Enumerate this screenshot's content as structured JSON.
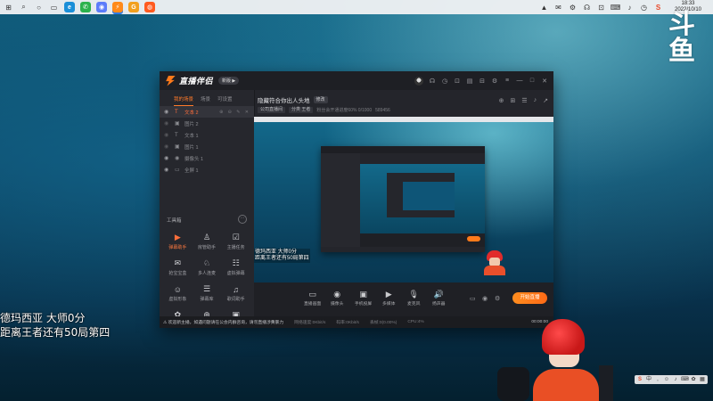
{
  "taskbar": {
    "left_icons": [
      {
        "name": "windows-icon",
        "glyph": "⊞"
      },
      {
        "name": "search-icon",
        "glyph": "⌕"
      },
      {
        "name": "circle-icon",
        "glyph": "○"
      },
      {
        "name": "task-view-icon",
        "glyph": "▭"
      }
    ],
    "apps": [
      {
        "name": "edge-app",
        "glyph": "e",
        "color": "#1b8fd8"
      },
      {
        "name": "wechat-app",
        "glyph": "✆",
        "color": "#2bb24c"
      },
      {
        "name": "browser-app",
        "glyph": "◉",
        "color": "#5c7cfa"
      },
      {
        "name": "live-companion-app",
        "glyph": "⚡",
        "color": "#ff8a1a",
        "active": true
      },
      {
        "name": "g-app",
        "glyph": "G",
        "color": "#f2a01e"
      },
      {
        "name": "firefox-app",
        "glyph": "◍",
        "color": "#ff5a1f"
      }
    ],
    "tray_icons": [
      "▲",
      "✉",
      "⚙",
      "☊",
      "⊡",
      "⌨",
      "♪",
      "◷",
      "S"
    ],
    "time": "18:33",
    "date": "2022/10/10"
  },
  "watermark": {
    "glyph": "斗鱼"
  },
  "app": {
    "name": "直播伴侣",
    "version_badge": "新版 ▶",
    "title_icons": [
      "☊",
      "◷",
      "⊡",
      "▤",
      "⊟",
      "⚙",
      "≡",
      "—",
      "□",
      "✕"
    ],
    "left_tabs": [
      {
        "label": "我的场景",
        "active": true
      },
      {
        "label": "场景",
        "active": false
      },
      {
        "label": "可设置",
        "active": false
      }
    ],
    "sources": [
      {
        "label": "文本 2",
        "icon": "T",
        "visible": true,
        "selected": true,
        "tools": "⊕ ⊖ ✎ ✕"
      },
      {
        "label": "图片 2",
        "icon": "▣",
        "visible": false,
        "selected": false
      },
      {
        "label": "文本 1",
        "icon": "T",
        "visible": false,
        "selected": false
      },
      {
        "label": "图片 1",
        "icon": "▣",
        "visible": false,
        "selected": false
      },
      {
        "label": "摄像头 1",
        "icon": "◉",
        "visible": true,
        "selected": false
      },
      {
        "label": "全屏 1",
        "icon": "▭",
        "visible": true,
        "selected": false
      }
    ],
    "tools_title": "工具箱",
    "tools_more": "···",
    "tools": [
      {
        "label": "弹幕助手",
        "icon": "▶",
        "hot": true
      },
      {
        "label": "房管助手",
        "icon": "♙",
        "hot": false
      },
      {
        "label": "主播任务",
        "icon": "☑",
        "hot": false
      },
      {
        "label": "抢宝宝盒",
        "icon": "✉",
        "hot": false
      },
      {
        "label": "多人连麦",
        "icon": "♘",
        "hot": false
      },
      {
        "label": "虚拟弹幕",
        "icon": "☷",
        "hot": false
      },
      {
        "label": "虚拟形象",
        "icon": "☺",
        "hot": false
      },
      {
        "label": "弹幕库",
        "icon": "☰",
        "hot": false
      },
      {
        "label": "歌词助手",
        "icon": "♫",
        "hot": false
      },
      {
        "label": "礼物",
        "icon": "✿",
        "hot": false
      },
      {
        "label": "更多",
        "icon": "⊕",
        "hot": false
      },
      {
        "label": "设置",
        "icon": "▣",
        "hot": false
      }
    ],
    "stream_title": "隐藏符合你出人头地",
    "mod_button": "修改",
    "stream_tags": [
      "公司直播间",
      "分类 王者"
    ],
    "stream_sub_text": "粉丝会开通进度60%  0/1000",
    "room_id": "589456",
    "right_icons": [
      "⊕",
      "⊞",
      "☰",
      "♪",
      "↗"
    ],
    "preview_overlay": [
      "德玛西亚  大师0分",
      "距离王者还有50局第四"
    ],
    "actions": [
      {
        "label": "直播画面",
        "icon": "▭"
      },
      {
        "label": "摄像头",
        "icon": "◉"
      },
      {
        "label": "手机投屏",
        "icon": "▣"
      },
      {
        "label": "多媒体",
        "icon": "▶"
      },
      {
        "label": "麦克风",
        "icon": "🎙"
      },
      {
        "label": "扬声器",
        "icon": "🔊"
      }
    ],
    "action_side_icons": [
      "▭",
      "◉",
      "⚙"
    ],
    "live_button": "开始直播",
    "status_notice": "⚠ 欢迎新主播，如遇问题请在公会内群咨询，请勿直播涉黄暴力",
    "stats": [
      "网络速度:0Kbit/s",
      "码率:0Kbit/s",
      "丢帧:0(0.00%)",
      "CPU:4%"
    ],
    "status_time": "00:00:00"
  },
  "overlay_text": [
    "德玛西亚  大师0分",
    "距离王者还有50局第四"
  ],
  "colors": {
    "accent": "#ff7a1a",
    "app_bg": "#24252b",
    "selected": "#ff6f3c"
  }
}
